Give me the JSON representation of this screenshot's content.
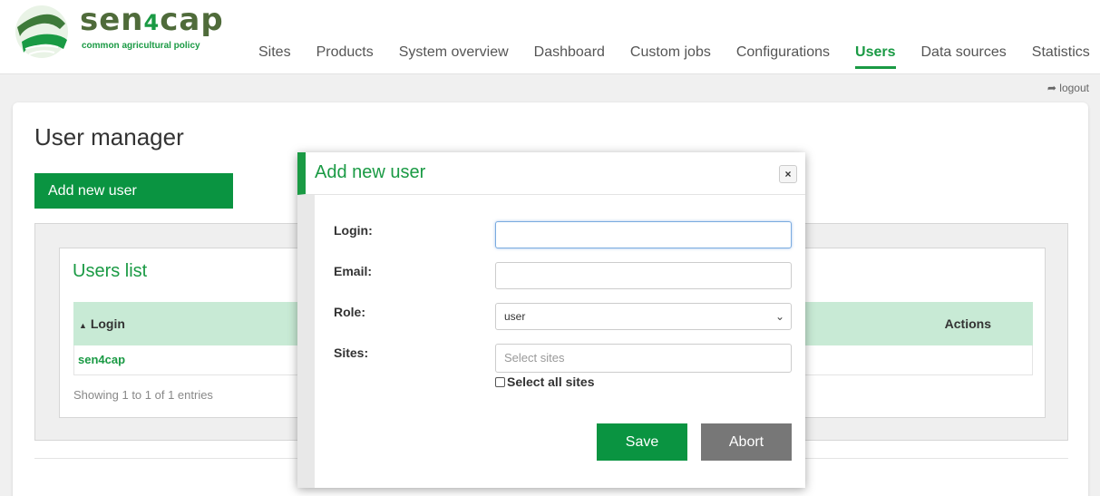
{
  "logo": {
    "brand_main": "sen",
    "brand_four": "4",
    "brand_end": "cap",
    "tagline": "common agricultural policy"
  },
  "nav": {
    "items": [
      {
        "label": "Sites"
      },
      {
        "label": "Products"
      },
      {
        "label": "System overview"
      },
      {
        "label": "Dashboard"
      },
      {
        "label": "Custom jobs"
      },
      {
        "label": "Configurations"
      },
      {
        "label": "Users"
      },
      {
        "label": "Data sources"
      },
      {
        "label": "Statistics"
      }
    ],
    "active_index": 6
  },
  "logout": {
    "label": "logout",
    "icon": "logout-icon"
  },
  "page": {
    "title": "User manager",
    "add_button_label": "Add new user"
  },
  "users_list": {
    "title": "Users list",
    "columns": [
      "Login",
      "Actions"
    ],
    "rows": [
      {
        "login": "sen4cap"
      }
    ],
    "footer": "Showing 1 to 1 of 1 entries"
  },
  "modal": {
    "title": "Add new user",
    "close_label": "×",
    "fields": {
      "login_label": "Login:",
      "login_value": "",
      "email_label": "Email:",
      "email_value": "",
      "role_label": "Role:",
      "role_value": "user",
      "sites_label": "Sites:",
      "sites_placeholder": "Select sites",
      "select_all_label": "Select all sites"
    },
    "save_label": "Save",
    "abort_label": "Abort"
  },
  "colors": {
    "brand_green": "#1a9a44",
    "button_green": "#0a9441",
    "table_head": "#c8ead5",
    "abort_gray": "#777777"
  }
}
